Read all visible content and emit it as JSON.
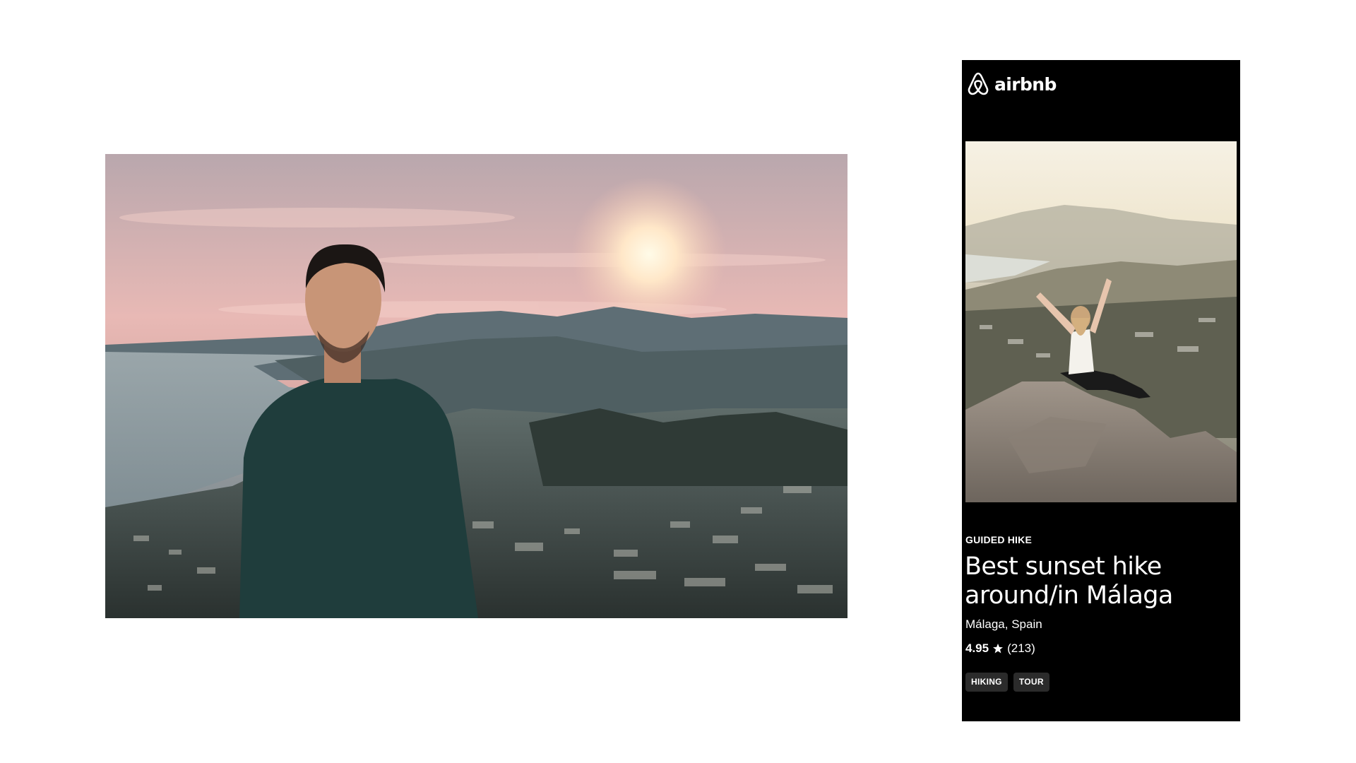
{
  "hero": {
    "image": "portrait-man-sunset-over-malaga-bay"
  },
  "card": {
    "brand": {
      "logo_icon": "airbnb-belo-icon",
      "name": "airbnb"
    },
    "image": "woman-arms-raised-on-rocky-summit",
    "category": "GUIDED HIKE",
    "title": "Best sunset hike around/in Málaga",
    "location": "Málaga, Spain",
    "rating": {
      "value": "4.95",
      "icon": "star-icon",
      "count": "(213)"
    },
    "tags": [
      {
        "label": "HIKING"
      },
      {
        "label": "TOUR"
      }
    ]
  },
  "colors": {
    "card_background": "#000000",
    "tag_background": "#2b2b2b",
    "page_background": "#ffffff"
  }
}
